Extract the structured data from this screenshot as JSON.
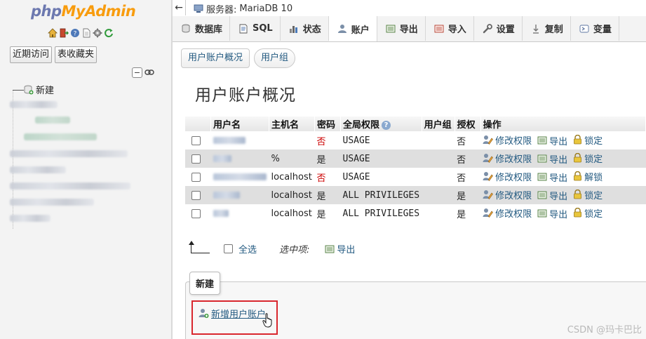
{
  "nav": {
    "logo_a": "php",
    "logo_b": "MyAdmin",
    "quick_icons": [
      "home-icon",
      "logout-icon",
      "help-icon",
      "docs-icon",
      "settings-icon",
      "reload-icon"
    ],
    "recent_button": "近期访问",
    "favorites_button": "表收藏夹",
    "tree_new": "新建"
  },
  "topbar": {
    "server_label": "服务器:",
    "server_name": "MariaDB 10"
  },
  "tabs": [
    {
      "label": "数据库",
      "icon": "database-icon"
    },
    {
      "label": "SQL",
      "icon": "sql-icon"
    },
    {
      "label": "状态",
      "icon": "status-icon"
    },
    {
      "label": "账户",
      "icon": "users-icon"
    },
    {
      "label": "导出",
      "icon": "export-icon"
    },
    {
      "label": "导入",
      "icon": "import-icon"
    },
    {
      "label": "设置",
      "icon": "wrench-icon"
    },
    {
      "label": "复制",
      "icon": "replication-icon"
    },
    {
      "label": "变量",
      "icon": "variables-icon"
    }
  ],
  "subtabs": {
    "overview": "用户账户概况",
    "groups": "用户组"
  },
  "page": {
    "title": "用户账户概况"
  },
  "table": {
    "headers": {
      "user": "用户名",
      "host": "主机名",
      "password": "密码",
      "privileges": "全局权限",
      "usergroup": "用户组",
      "grant": "授权",
      "action": "操作"
    },
    "rows": [
      {
        "host": "",
        "password": "否",
        "privileges": "USAGE",
        "grant": "否",
        "lock": "锁定"
      },
      {
        "host": "%",
        "password": "是",
        "privileges": "USAGE",
        "grant": "否",
        "lock": "锁定"
      },
      {
        "host": "localhost",
        "password": "否",
        "privileges": "USAGE",
        "grant": "否",
        "lock": "解锁"
      },
      {
        "host": "localhost",
        "password": "是",
        "privileges": "ALL PRIVILEGES",
        "grant": "是",
        "lock": "锁定"
      },
      {
        "host": "localhost",
        "password": "是",
        "privileges": "ALL PRIVILEGES",
        "grant": "是",
        "lock": "锁定"
      }
    ],
    "edit_label": "修改权限",
    "export_label": "导出"
  },
  "bulk": {
    "select_all": "全选",
    "with_selected": "选中项:",
    "export": "导出"
  },
  "new_section": {
    "legend": "新建",
    "add_user": "新增用户账户"
  },
  "watermark": "CSDN @玛卡巴比",
  "colors": {
    "link": "#235a81",
    "highlight": "#d9272e",
    "no_password": "#cc0000"
  }
}
